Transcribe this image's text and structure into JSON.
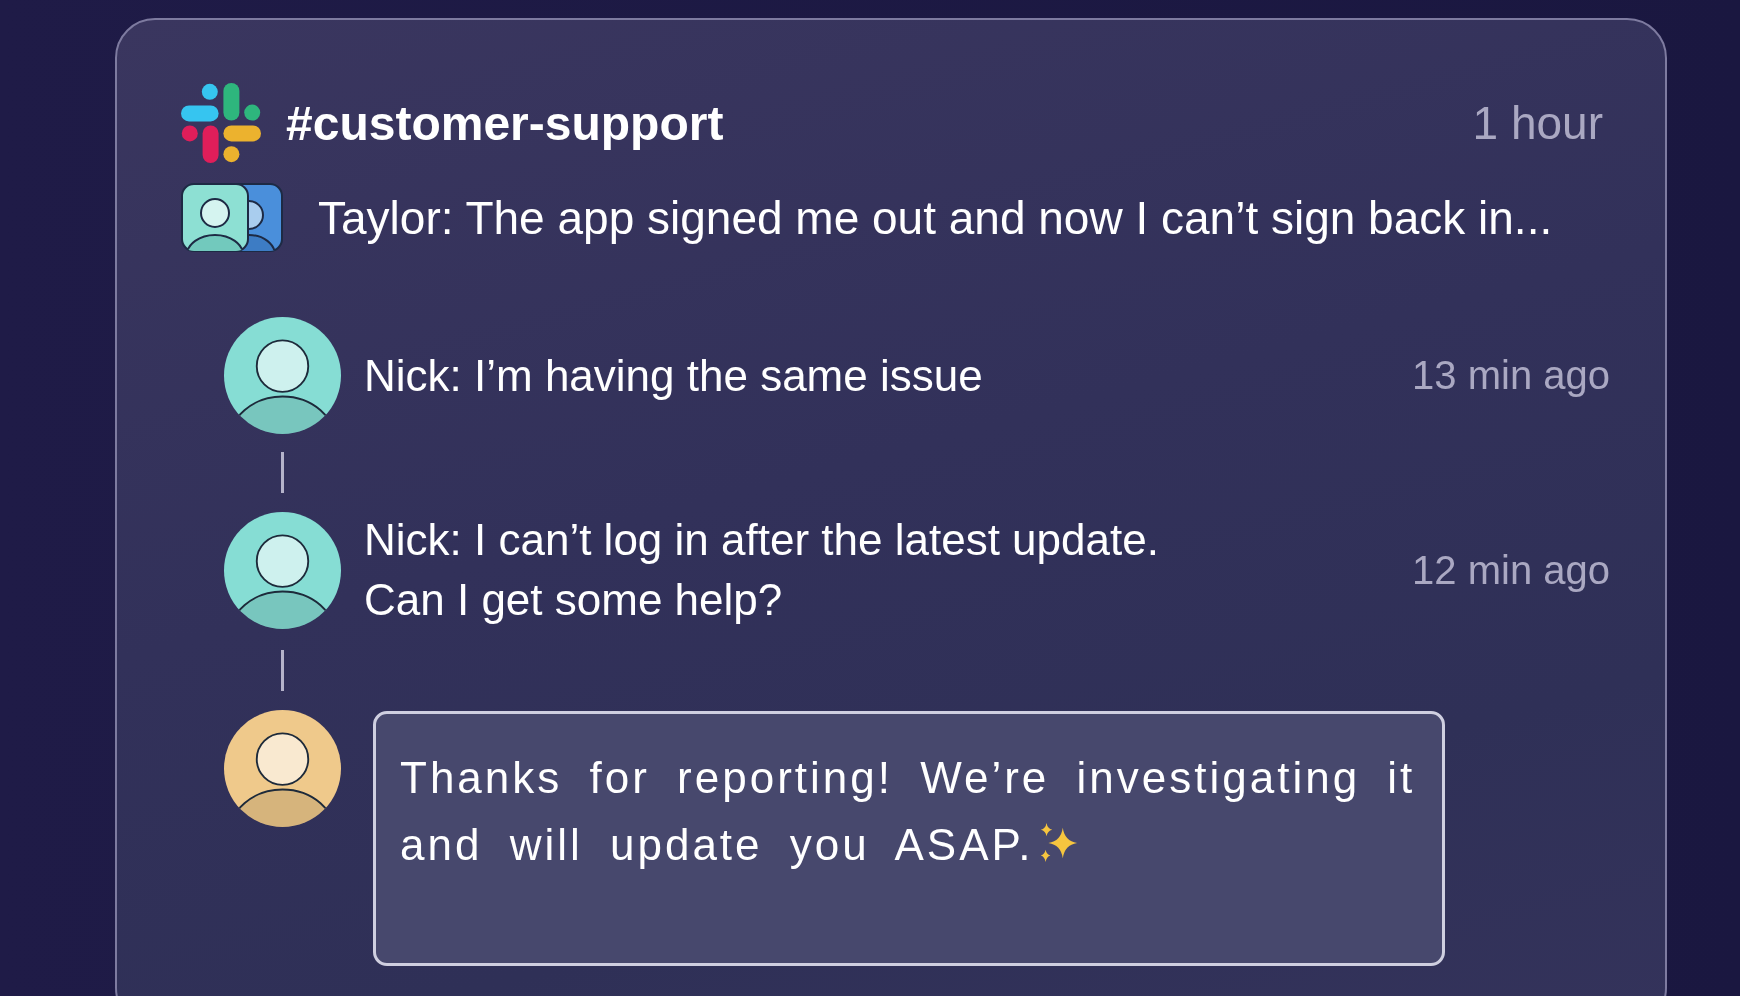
{
  "channel": {
    "name": "#customer-support",
    "time": "1 hour"
  },
  "preview": {
    "text": "Taylor: The app signed me out and now I can’t sign back in..."
  },
  "replies": [
    {
      "text": "Nick: I’m having the same issue",
      "time": "13 min ago",
      "color": "#86ddd4"
    },
    {
      "text": "Nick: I can’t log in after the latest update.\nCan I get some help?",
      "time": "12 min ago",
      "color": "#86ddd4"
    }
  ],
  "composer": {
    "color": "#efc98b",
    "value": "Thanks for reporting! We’re investigating it and will update you ASAP."
  }
}
